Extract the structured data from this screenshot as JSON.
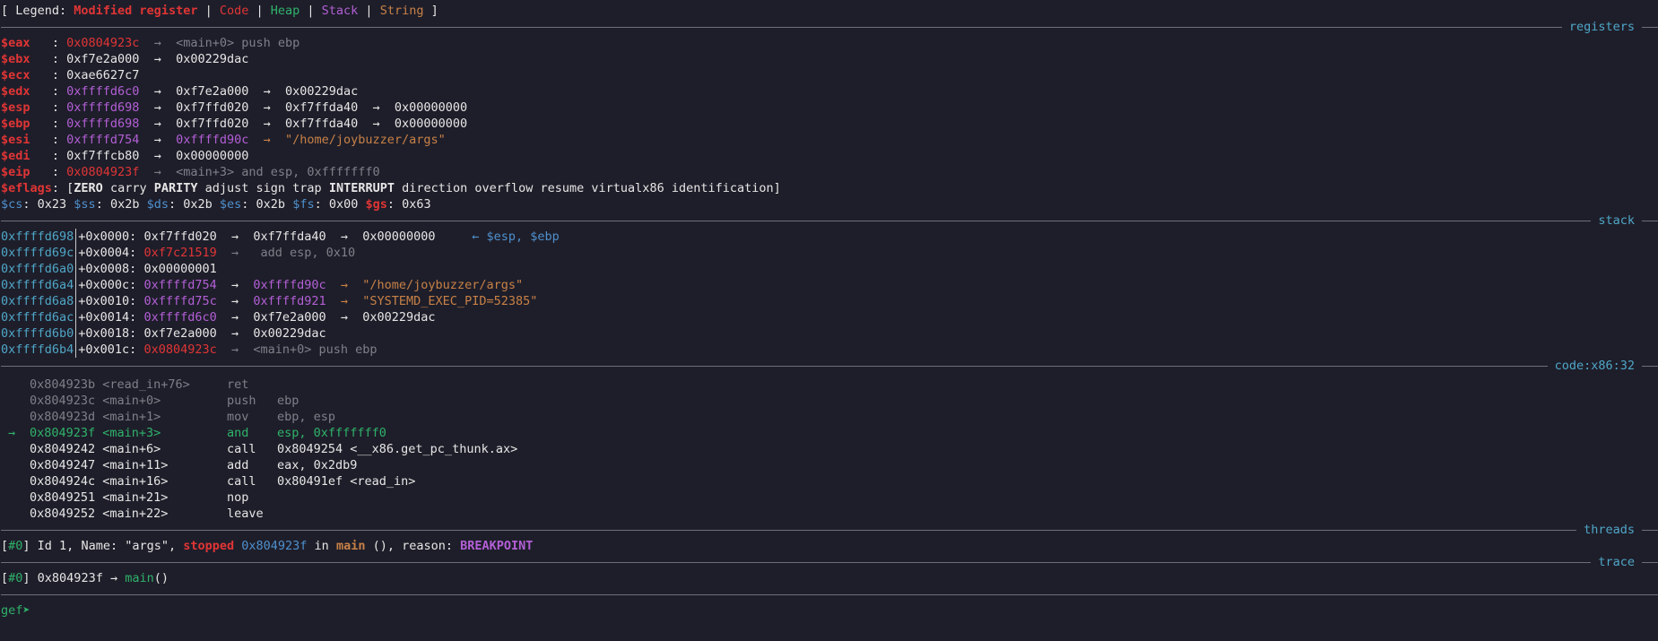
{
  "legend": {
    "prefix": "[ Legend: ",
    "modified": "Modified register",
    "sep": " | ",
    "code": "Code",
    "heap": "Heap",
    "stack": "Stack",
    "string": "String",
    "suffix": " ]"
  },
  "sections": {
    "registers": "registers",
    "stack": "stack",
    "code": "code:x86:32",
    "threads": "threads",
    "trace": "trace"
  },
  "registers": [
    {
      "name": "$eax",
      "colon": "   : ",
      "value": "0x0804923c",
      "chain": "  →  <main+0> push ebp"
    },
    {
      "name": "$ebx",
      "colon": "   : ",
      "value": "0xf7e2a000",
      "chain": "  →  0x00229dac"
    },
    {
      "name": "$ecx",
      "colon": "   : ",
      "value": "0xae6627c7",
      "chain": ""
    },
    {
      "name": "$edx",
      "colon": "   : ",
      "value": "0xffffd6c0",
      "chain": "  →  0xf7e2a000  →  0x00229dac"
    },
    {
      "name": "$esp",
      "colon": "   : ",
      "value": "0xffffd698",
      "chain": "  →  0xf7ffd020  →  0xf7ffda40  →  0x00000000"
    },
    {
      "name": "$ebp",
      "colon": "   : ",
      "value": "0xffffd698",
      "chain": "  →  0xf7ffd020  →  0xf7ffda40  →  0x00000000"
    },
    {
      "name": "$esi",
      "colon": "   : ",
      "value": "0xffffd754",
      "chain_mid": "  →  ",
      "chain_val": "0xffffd90c",
      "chain_str": "  →  \"/home/joybuzzer/args\""
    },
    {
      "name": "$edi",
      "colon": "   : ",
      "value": "0xf7ffcb80",
      "chain": "  →  0x00000000"
    },
    {
      "name": "$eip",
      "colon": "   : ",
      "value": "0x0804923f",
      "chain": "  →  <main+3> and esp, 0xfffffff0"
    }
  ],
  "eflags": {
    "label": "$eflags",
    "open": ": [",
    "ZERO": "ZERO",
    "carry": " carry ",
    "PARITY": "PARITY",
    "mid": " adjust sign trap ",
    "INTERRUPT": "INTERRUPT",
    "rest": " direction overflow resume virtualx86 identification]"
  },
  "segments": [
    {
      "name": "$cs",
      "value": ": 0x23 "
    },
    {
      "name": "$ss",
      "value": ": 0x2b "
    },
    {
      "name": "$ds",
      "value": ": 0x2b "
    },
    {
      "name": "$es",
      "value": ": 0x2b "
    },
    {
      "name": "$fs",
      "value": ": 0x00 "
    },
    {
      "name": "$gs",
      "value": ": 0x63"
    }
  ],
  "stack": [
    {
      "addr": "0xffffd698",
      "off": "+0x0000: ",
      "v1": "0xf7ffd020",
      "rest": "  →  0xf7ffda40  →  0x00000000     ",
      "note": "← $esp, $ebp"
    },
    {
      "addr": "0xffffd69c",
      "off": "+0x0004: ",
      "v1": "0xf7c21519",
      "rest": "  →   add esp, 0x10"
    },
    {
      "addr": "0xffffd6a0",
      "off": "+0x0008: ",
      "v1": "0x00000001",
      "rest": ""
    },
    {
      "addr": "0xffffd6a4",
      "off": "+0x000c: ",
      "v1": "0xffffd754",
      "arrow": "  →  ",
      "v2": "0xffffd90c",
      "str": "  →  \"/home/joybuzzer/args\""
    },
    {
      "addr": "0xffffd6a8",
      "off": "+0x0010: ",
      "v1": "0xffffd75c",
      "arrow": "  →  ",
      "v2": "0xffffd921",
      "str": "  →  \"SYSTEMD_EXEC_PID=52385\""
    },
    {
      "addr": "0xffffd6ac",
      "off": "+0x0014: ",
      "v1": "0xffffd6c0",
      "rest": "  →  0xf7e2a000  →  0x00229dac"
    },
    {
      "addr": "0xffffd6b0",
      "off": "+0x0018: ",
      "v1": "0xf7e2a000",
      "rest": "  →  0x00229dac"
    },
    {
      "addr": "0xffffd6b4",
      "off": "+0x001c: ",
      "v1": "0x0804923c",
      "rest": "  →  <main+0> push ebp"
    }
  ],
  "code": [
    {
      "marker": "",
      "addr": "0x804923b <read_in+76>",
      "mn": "ret",
      "ops": ""
    },
    {
      "marker": "",
      "addr": "0x804923c <main+0>",
      "mn": "push",
      "ops": "ebp"
    },
    {
      "marker": "",
      "addr": "0x804923d <main+1>",
      "mn": "mov",
      "ops": "ebp, esp"
    },
    {
      "marker": "→",
      "addr": "0x804923f <main+3>",
      "mn": "and",
      "ops": "esp, 0xfffffff0"
    },
    {
      "marker": "",
      "addr": "0x8049242 <main+6>",
      "mn": "call",
      "ops": "0x8049254 <__x86.get_pc_thunk.ax>"
    },
    {
      "marker": "",
      "addr": "0x8049247 <main+11>",
      "mn": "add",
      "ops": "eax, 0x2db9"
    },
    {
      "marker": "",
      "addr": "0x804924c <main+16>",
      "mn": "call",
      "ops": "0x80491ef <read_in>"
    },
    {
      "marker": "",
      "addr": "0x8049251 <main+21>",
      "mn": "nop",
      "ops": ""
    },
    {
      "marker": "",
      "addr": "0x8049252 <main+22>",
      "mn": "leave",
      "ops": ""
    }
  ],
  "threads": {
    "open": "[",
    "num": "#0",
    "close": "] ",
    "text1": "Id 1, Name: \"args\", ",
    "stopped": "stopped",
    "addr": " 0x804923f",
    "in": " in ",
    "fn": "main",
    "reason_pre": " (), reason: ",
    "reason": "BREAKPOINT"
  },
  "trace": {
    "open": "[",
    "num": "#0",
    "close": "] ",
    "addr": "0x804923f → ",
    "fn": "main",
    "tail": "()"
  },
  "prompt": "gef➤ "
}
